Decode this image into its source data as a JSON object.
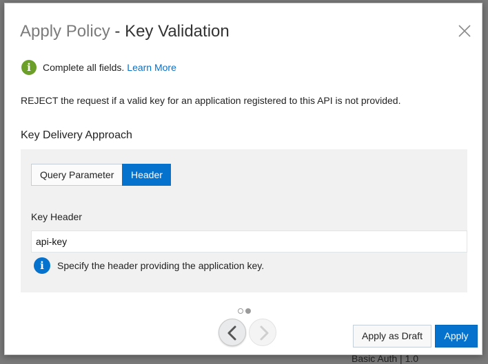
{
  "background": {
    "fragment": "Basic Auth | 1.0"
  },
  "dialog": {
    "title_main": "Apply Policy",
    "title_sub": " - Key Validation",
    "info_message": "Complete all fields.",
    "learn_more": "Learn More",
    "description": "REJECT the request if a valid key for an application registered to this API is not provided.",
    "section_heading": "Key Delivery Approach",
    "segmented": {
      "options": [
        "Query Parameter",
        "Header"
      ],
      "selected": "Header"
    },
    "field": {
      "label": "Key Header",
      "value": "api-key"
    },
    "hint": "Specify the header providing the application key.",
    "pagination": {
      "pages": 2,
      "current": 2
    },
    "buttons": {
      "draft": "Apply as Draft",
      "apply": "Apply"
    }
  },
  "colors": {
    "accent": "#0572ce",
    "success_icon": "#6b9f2a"
  },
  "icons": {
    "close": "close-icon",
    "info_success": "info-icon",
    "info_hint": "info-icon",
    "prev": "chevron-left-icon",
    "next": "chevron-right-icon"
  }
}
